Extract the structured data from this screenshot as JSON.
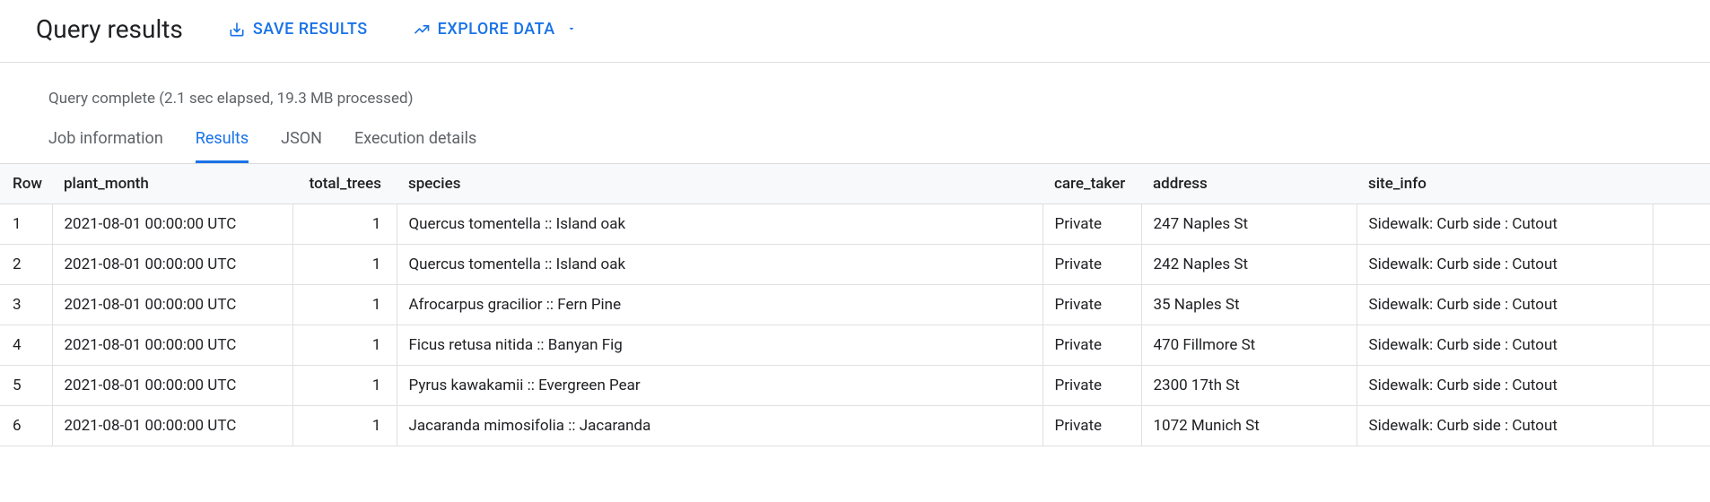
{
  "header": {
    "title": "Query results",
    "save_label": "SAVE RESULTS",
    "explore_label": "EXPLORE DATA"
  },
  "status": {
    "text": "Query complete (2.1 sec elapsed, 19.3 MB processed)"
  },
  "tabs": {
    "job_info": "Job information",
    "results": "Results",
    "json": "JSON",
    "execution": "Execution details"
  },
  "columns": {
    "row": "Row",
    "plant_month": "plant_month",
    "total_trees": "total_trees",
    "species": "species",
    "care_taker": "care_taker",
    "address": "address",
    "site_info": "site_info"
  },
  "rows": [
    {
      "n": "1",
      "plant_month": "2021-08-01 00:00:00 UTC",
      "total_trees": "1",
      "species": "Quercus tomentella :: Island oak",
      "care_taker": "Private",
      "address": "247 Naples St",
      "site_info": "Sidewalk: Curb side : Cutout"
    },
    {
      "n": "2",
      "plant_month": "2021-08-01 00:00:00 UTC",
      "total_trees": "1",
      "species": "Quercus tomentella :: Island oak",
      "care_taker": "Private",
      "address": "242 Naples St",
      "site_info": "Sidewalk: Curb side : Cutout"
    },
    {
      "n": "3",
      "plant_month": "2021-08-01 00:00:00 UTC",
      "total_trees": "1",
      "species": "Afrocarpus gracilior :: Fern Pine",
      "care_taker": "Private",
      "address": "35 Naples St",
      "site_info": "Sidewalk: Curb side : Cutout"
    },
    {
      "n": "4",
      "plant_month": "2021-08-01 00:00:00 UTC",
      "total_trees": "1",
      "species": "Ficus retusa nitida :: Banyan Fig",
      "care_taker": "Private",
      "address": "470 Fillmore St",
      "site_info": "Sidewalk: Curb side : Cutout"
    },
    {
      "n": "5",
      "plant_month": "2021-08-01 00:00:00 UTC",
      "total_trees": "1",
      "species": "Pyrus kawakamii :: Evergreen Pear",
      "care_taker": "Private",
      "address": "2300 17th St",
      "site_info": "Sidewalk: Curb side : Cutout"
    },
    {
      "n": "6",
      "plant_month": "2021-08-01 00:00:00 UTC",
      "total_trees": "1",
      "species": "Jacaranda mimosifolia :: Jacaranda",
      "care_taker": "Private",
      "address": "1072 Munich St",
      "site_info": "Sidewalk: Curb side : Cutout"
    }
  ]
}
